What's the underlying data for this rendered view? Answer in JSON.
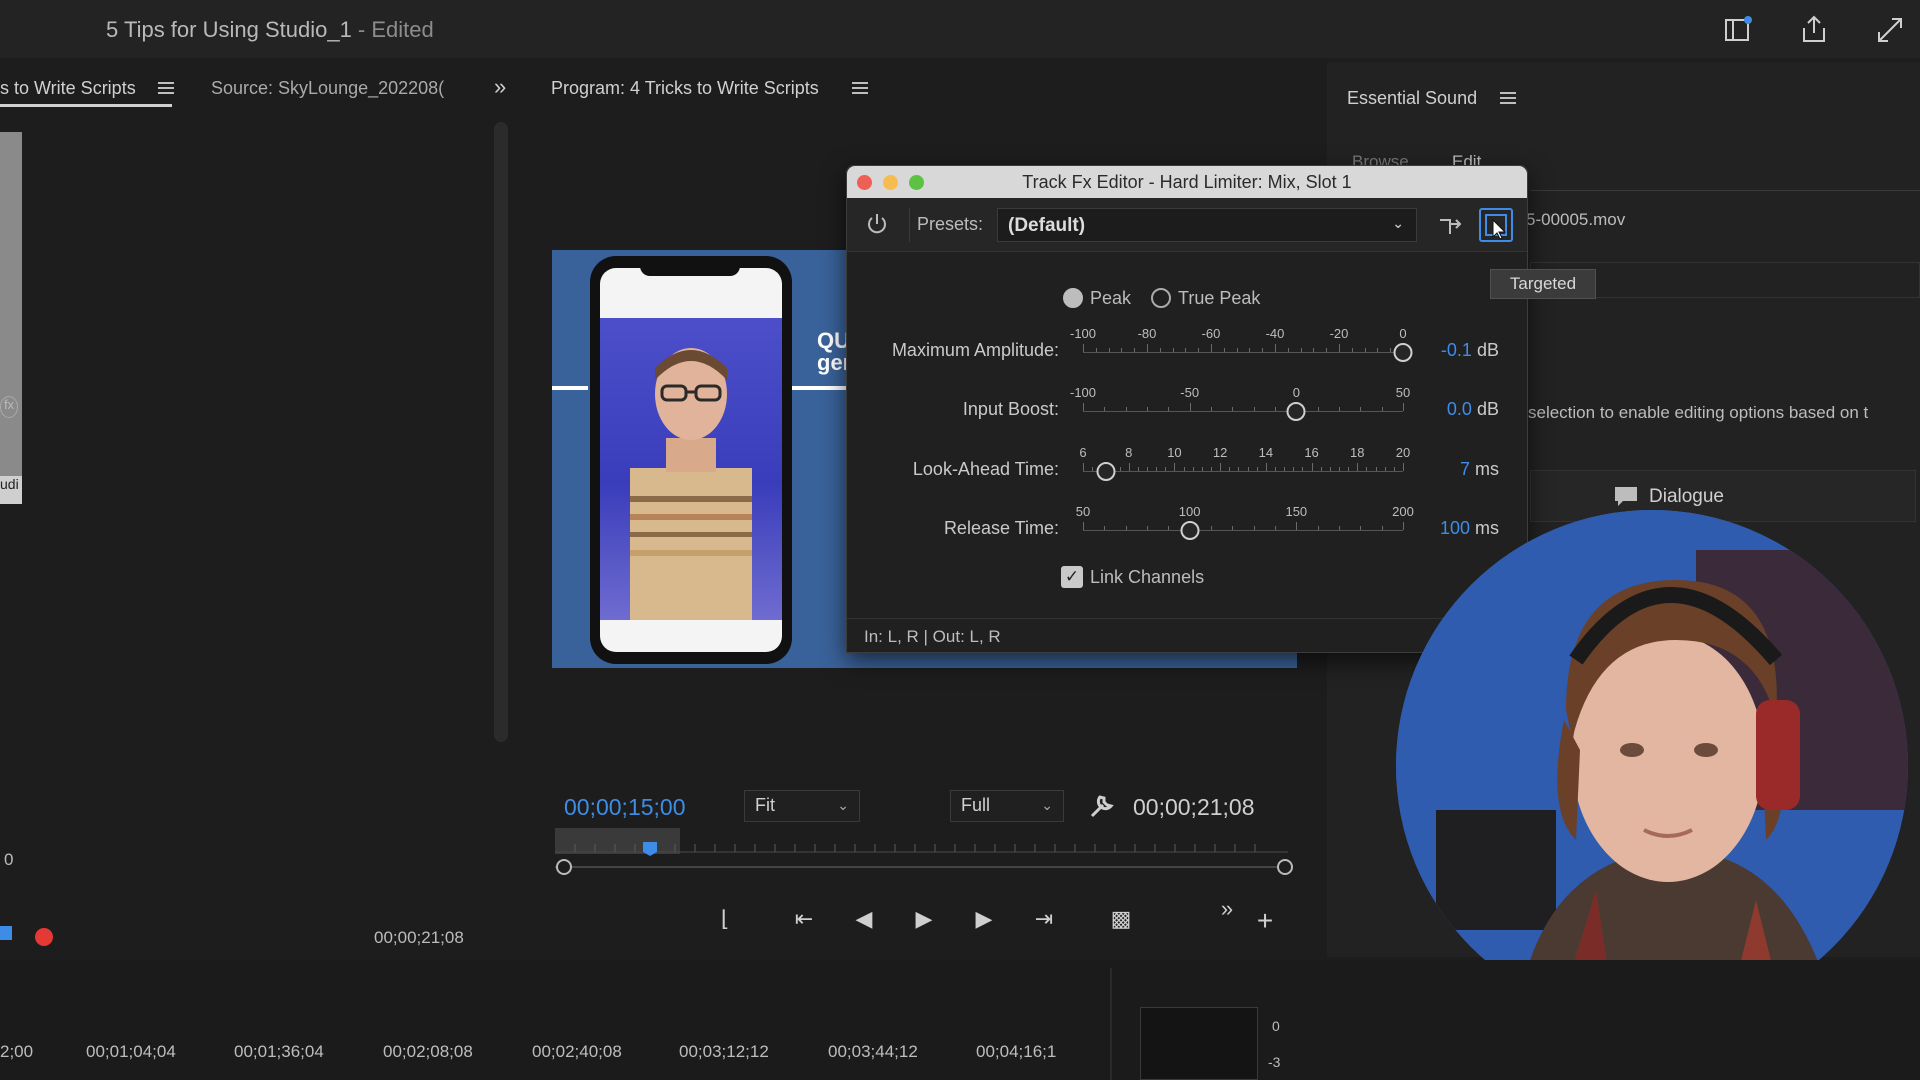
{
  "window": {
    "title": "5 Tips for Using Studio_1",
    "edited_suffix": " - Edited"
  },
  "source_panel": {
    "tab_active": "s to Write Scripts",
    "tab_source": "Source: SkyLounge_202208(",
    "timecode": "00;00;21;08",
    "left_labels": {
      "fx": "fx",
      "udi": "udi",
      "zero": "0"
    }
  },
  "program": {
    "tab_title": "Program: 4 Tricks to Write Scripts",
    "current_timecode": "00;00;15;00",
    "duration_timecode": "00;00;21;08",
    "zoom_select": "Fit",
    "quality_select": "Full",
    "overlay_text_line1": "QUI",
    "overlay_text_line2": "ger"
  },
  "essential_sound": {
    "title": "Essential Sound",
    "tab_browse": "Browse",
    "tab_edit": "Edit",
    "clip_name": "5-00005.mov",
    "hint_text": "selection to enable editing options based on t",
    "dialogue_label": "Dialogue"
  },
  "fx_editor": {
    "title": "Track Fx Editor - Hard Limiter: Mix, Slot 1",
    "presets_label": "Presets:",
    "presets_value": "(Default)",
    "mode_peak": "Peak",
    "mode_true_peak": "True Peak",
    "mode_selected": "Peak",
    "params": [
      {
        "label": "Maximum Amplitude:",
        "value": "-0.1",
        "unit": "dB",
        "ticks": [
          "-100",
          "-80",
          "-60",
          "-40",
          "-20",
          "0"
        ],
        "range": [
          -100,
          0
        ],
        "current": -0.1
      },
      {
        "label": "Input Boost:",
        "value": "0.0",
        "unit": "dB",
        "ticks": [
          "-100",
          "-50",
          "0",
          "50"
        ],
        "range": [
          -100,
          50
        ],
        "current": 0
      },
      {
        "label": "Look-Ahead Time:",
        "value": "7",
        "unit": "ms",
        "ticks": [
          "6",
          "8",
          "10",
          "12",
          "14",
          "16",
          "18",
          "20"
        ],
        "range": [
          6,
          20
        ],
        "current": 7
      },
      {
        "label": "Release Time:",
        "value": "100",
        "unit": "ms",
        "ticks": [
          "50",
          "100",
          "150",
          "200"
        ],
        "range": [
          50,
          200
        ],
        "current": 100
      }
    ],
    "link_channels_label": "Link Channels",
    "link_channels_checked": true,
    "io_status": "In: L, R | Out: L, R",
    "tooltip": "Targeted"
  },
  "timeline": {
    "ruler": [
      "2;00",
      "00;01;04;04",
      "00;01;36;04",
      "00;02;08;08",
      "00;02;40;08",
      "00;03;12;12",
      "00;03;44;12",
      "00;04;16;1"
    ],
    "meter_labels": [
      "0",
      "-3"
    ]
  },
  "icons": {
    "power": "power-icon",
    "targeted": "targeted-icon",
    "routing": "routing-icon"
  },
  "colors": {
    "accent_blue": "#3d8ce8",
    "traffic_close": "#ee5f56",
    "traffic_min": "#f5bd4f",
    "traffic_max": "#5bc244",
    "record_red": "#e53935"
  }
}
